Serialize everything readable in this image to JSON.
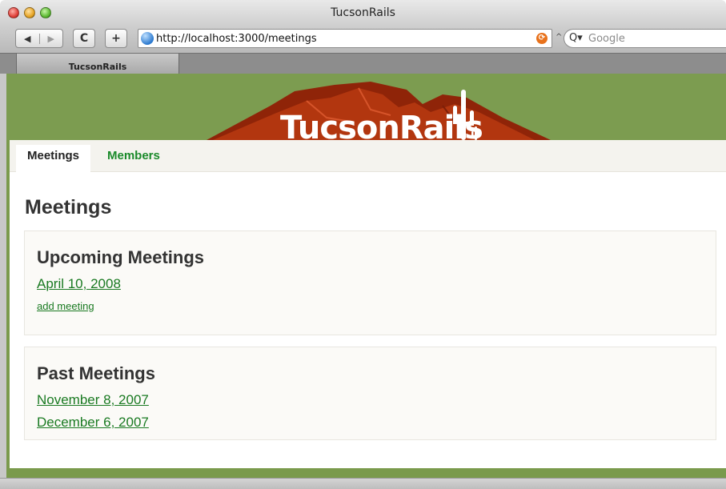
{
  "window": {
    "title": "TucsonRails",
    "url": "http://localhost:3000/meetings",
    "search_placeholder": "Google",
    "tab_label": "TucsonRails"
  },
  "toolbar": {
    "back_glyph": "◀",
    "forward_glyph": "▶",
    "reload_glyph": "C",
    "add_glyph": "+"
  },
  "banner": {
    "brand": "TucsonRails",
    "colors": {
      "sky": "#7c9c50",
      "mountain": "#b2360f",
      "mountain_shadow": "#7e1f08"
    }
  },
  "nav": {
    "items": [
      {
        "label": "Meetings",
        "active": true
      },
      {
        "label": "Members",
        "active": false
      }
    ]
  },
  "main": {
    "heading": "Meetings",
    "upcoming": {
      "heading": "Upcoming Meetings",
      "meetings": [
        "April 10, 2008"
      ],
      "add_link": "add meeting"
    },
    "past": {
      "heading": "Past Meetings",
      "meetings": [
        "November 8, 2007",
        "December 6, 2007"
      ]
    }
  },
  "colors": {
    "link": "#1a7a22",
    "nav_active_link": "#1a8a2a",
    "frame_green": "#7a9a4c"
  }
}
